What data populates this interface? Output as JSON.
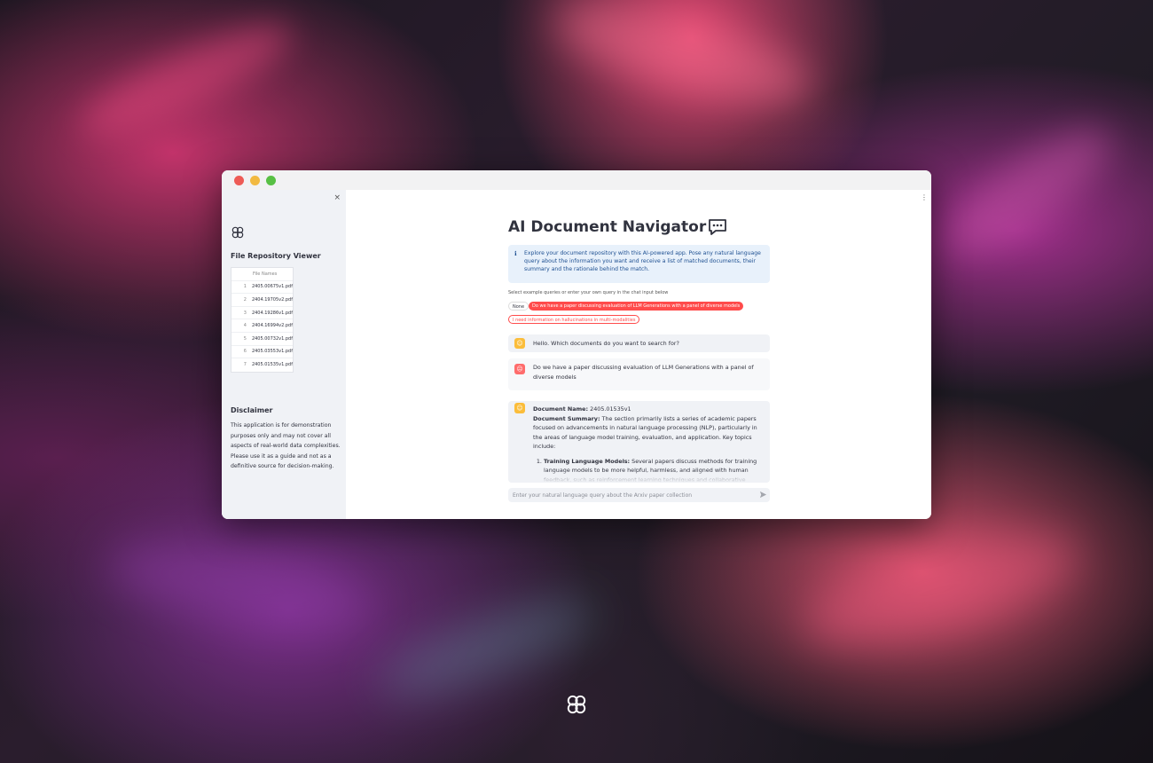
{
  "window": {
    "controls": [
      "close",
      "minimize",
      "maximize"
    ]
  },
  "sidebar": {
    "close_glyph": "×",
    "logo_icon": "clover-logo-icon",
    "title": "File Repository Viewer",
    "table": {
      "header": "File Names",
      "rows": [
        {
          "idx": "1",
          "name": "2405.00675v1.pdf"
        },
        {
          "idx": "2",
          "name": "2404.19705v2.pdf"
        },
        {
          "idx": "3",
          "name": "2404.19286v1.pdf"
        },
        {
          "idx": "4",
          "name": "2404.16994v2.pdf"
        },
        {
          "idx": "5",
          "name": "2405.00732v1.pdf"
        },
        {
          "idx": "6",
          "name": "2405.03553v1.pdf"
        },
        {
          "idx": "7",
          "name": "2405.01535v1.pdf"
        }
      ]
    },
    "disclaimer_title": "Disclaimer",
    "disclaimer_text": "This application is for demonstration purposes only and may not cover all aspects of real-world data complexities. Please use it as a guide and not as a definitive source for decision-making."
  },
  "main": {
    "menu_glyph": "⋮",
    "title": "AI Document Navigator",
    "title_icon": "speech-bubble-icon",
    "info": {
      "icon": "ℹ",
      "text": "Explore your document repository with this AI-powered app. Pose any natural language query about the information you want and receive a list of matched documents, their summary and the rationale behind the match."
    },
    "select_label": "Select example queries or enter your own query in the chat input below",
    "pills": {
      "none": "None",
      "selected": "Do we have a paper discussing evaluation of LLM Generations with a panel of diverse models",
      "other": "I need information on hallucinations in multi-modalities"
    },
    "messages": {
      "bot_greeting": "Hello. Which documents do you want to search for?",
      "user_query": "Do we have a paper discussing evaluation of LLM Generations with a panel of diverse models",
      "response": {
        "doc_name_label": "Document Name:",
        "doc_name": "2405.01535v1",
        "summary_label": "Document Summary:",
        "summary": "The section primarily lists a series of academic papers focused on advancements in natural language processing (NLP), particularly in the areas of language model training, evaluation, and application. Key topics include:",
        "item1_label": "Training Language Models:",
        "item1": "Several papers discuss methods for training language models to be more helpful, harmless, and aligned with human feedback, such as reinforcement learning techniques and collaborative"
      }
    },
    "chat_input": {
      "placeholder": "Enter your natural language query about the Arxiv paper collection",
      "value": ""
    },
    "send_icon": "send-icon"
  }
}
